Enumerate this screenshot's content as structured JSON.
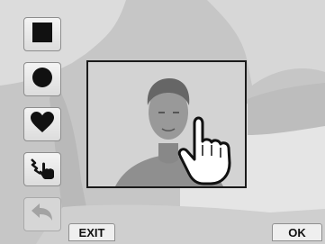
{
  "toolbar": {
    "tools": [
      {
        "icon": "square-icon"
      },
      {
        "icon": "circle-icon"
      },
      {
        "icon": "heart-icon"
      },
      {
        "icon": "custom-draw-icon"
      },
      {
        "icon": "undo-icon",
        "enabled": false
      }
    ]
  },
  "footer": {
    "exit_label": "EXIT",
    "ok_label": "OK"
  },
  "colors": {
    "icon": "#111111",
    "frame_border": "#1a1a1a",
    "background": "#c9c9c9"
  }
}
